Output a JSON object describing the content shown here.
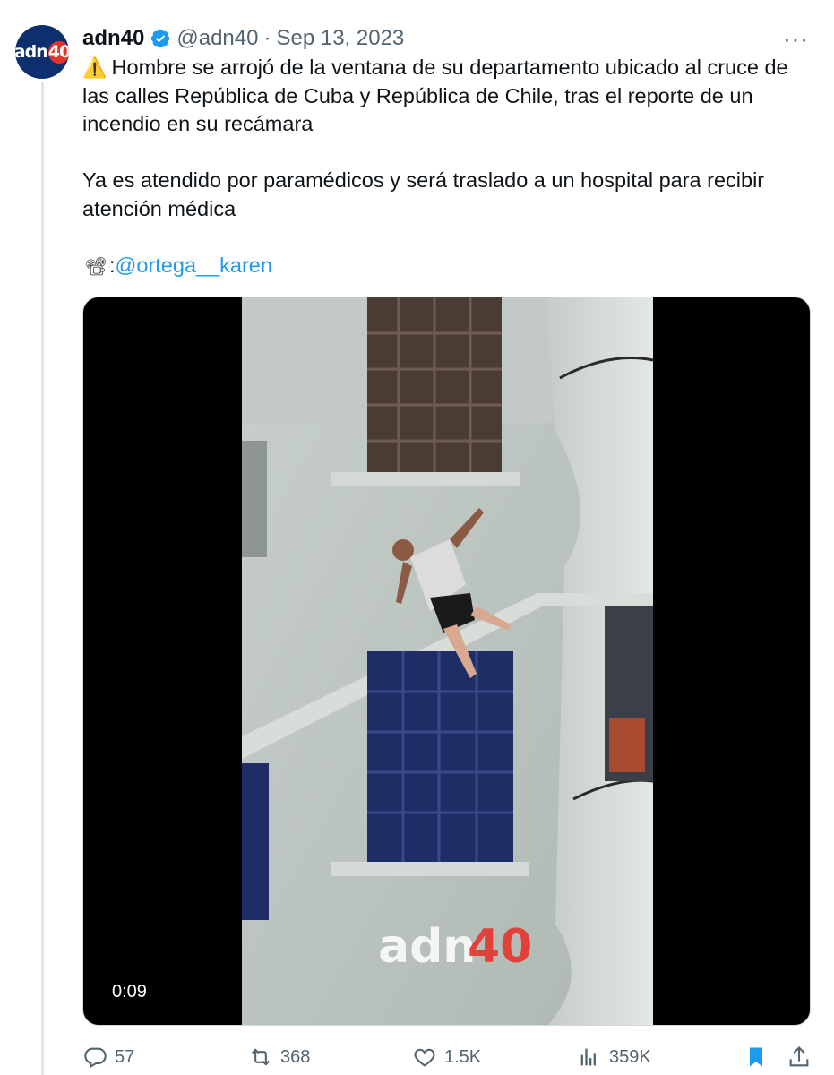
{
  "author": {
    "display_name": "adn40",
    "handle": "@adn40",
    "separator": "·",
    "date": "Sep 13, 2023",
    "avatar_text": "adn",
    "avatar_num": "40",
    "verified_icon": "verified-badge-icon",
    "verified_color": "#1d9bf0"
  },
  "more_label": "···",
  "tweet": {
    "line1": "Hombre se arrojó de la ventana de su departamento ubicado al cruce de las calles República de Cuba y República de Chile, tras el reporte de un incendio en su recámara",
    "line2": "Ya es atendido por paramédicos y será traslado a un hospital para recibir atención médica",
    "credit_mention": "@ortega__karen",
    "credit_prefix": ":",
    "warn_emoji": "⚠️",
    "camera_emoji": "📽"
  },
  "media": {
    "timestamp": "0:09",
    "watermark_text": "adn",
    "watermark_num": "40"
  },
  "actions": {
    "replies": "57",
    "retweets": "368",
    "likes": "1.5K",
    "views": "359K"
  },
  "colors": {
    "accent": "#1d9bf0",
    "muted": "#536471",
    "text": "#0f1419",
    "brand_navy": "#0c2f6e",
    "brand_red": "#e4332b"
  }
}
